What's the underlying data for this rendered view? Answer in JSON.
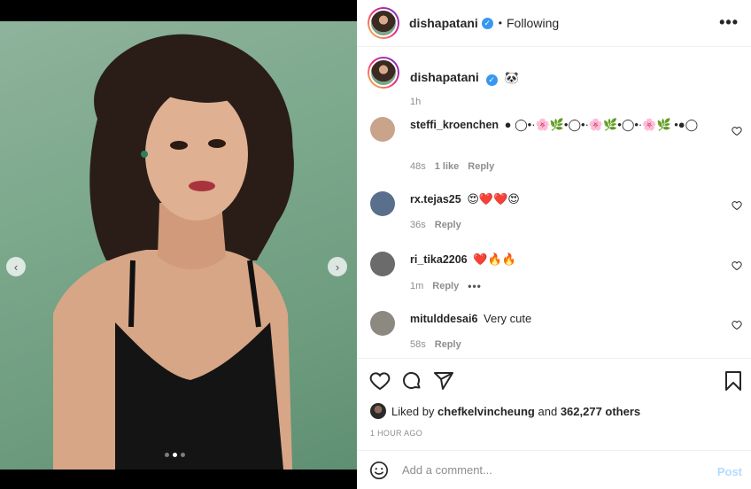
{
  "media": {
    "carousel_count": 3,
    "carousel_active_index": 1,
    "prev_icon": "chevron-left-icon",
    "next_icon": "chevron-right-icon",
    "prev_glyph": "‹",
    "next_glyph": "›"
  },
  "header": {
    "username": "dishapatani",
    "verified_glyph": "✓",
    "separator": "•",
    "follow_status": "Following",
    "more_glyph": "•••"
  },
  "caption": {
    "username": "dishapatani",
    "emoji": "🐼",
    "time": "1h"
  },
  "comments": [
    {
      "username": "steffi_kroenchen",
      "text": "● ◯•·🌸🌿•◯•·🌸🌿•◯•·🌸🌿 •●◯",
      "time": "48s",
      "likes": "1 like",
      "reply": "Reply",
      "avatar_color": "#c9a48a"
    },
    {
      "username": "rx.tejas25",
      "text": "😍❤️❤️😍",
      "time": "36s",
      "likes": "",
      "reply": "Reply",
      "avatar_color": "#5a6f8c"
    },
    {
      "username": "ri_tika2206",
      "text": "❤️🔥🔥",
      "time": "1m",
      "likes": "",
      "reply": "Reply",
      "avatar_color": "#6b6b6b",
      "more": "•••"
    },
    {
      "username": "mitulddesai6",
      "text": "Very cute",
      "time": "58s",
      "likes": "",
      "reply": "Reply",
      "avatar_color": "#8c8a80"
    }
  ],
  "likes": {
    "prefix": "Liked by",
    "user": "chefkelvincheung",
    "middle": "and",
    "count": "362,277 others"
  },
  "timestamp": "1 HOUR AGO",
  "add_comment": {
    "placeholder": "Add a comment...",
    "post_label": "Post",
    "icon": "smile-icon"
  },
  "colors": {
    "accent": "#3897f0",
    "post_disabled": "#b3dbff",
    "photo_bg": "#7da98d"
  }
}
